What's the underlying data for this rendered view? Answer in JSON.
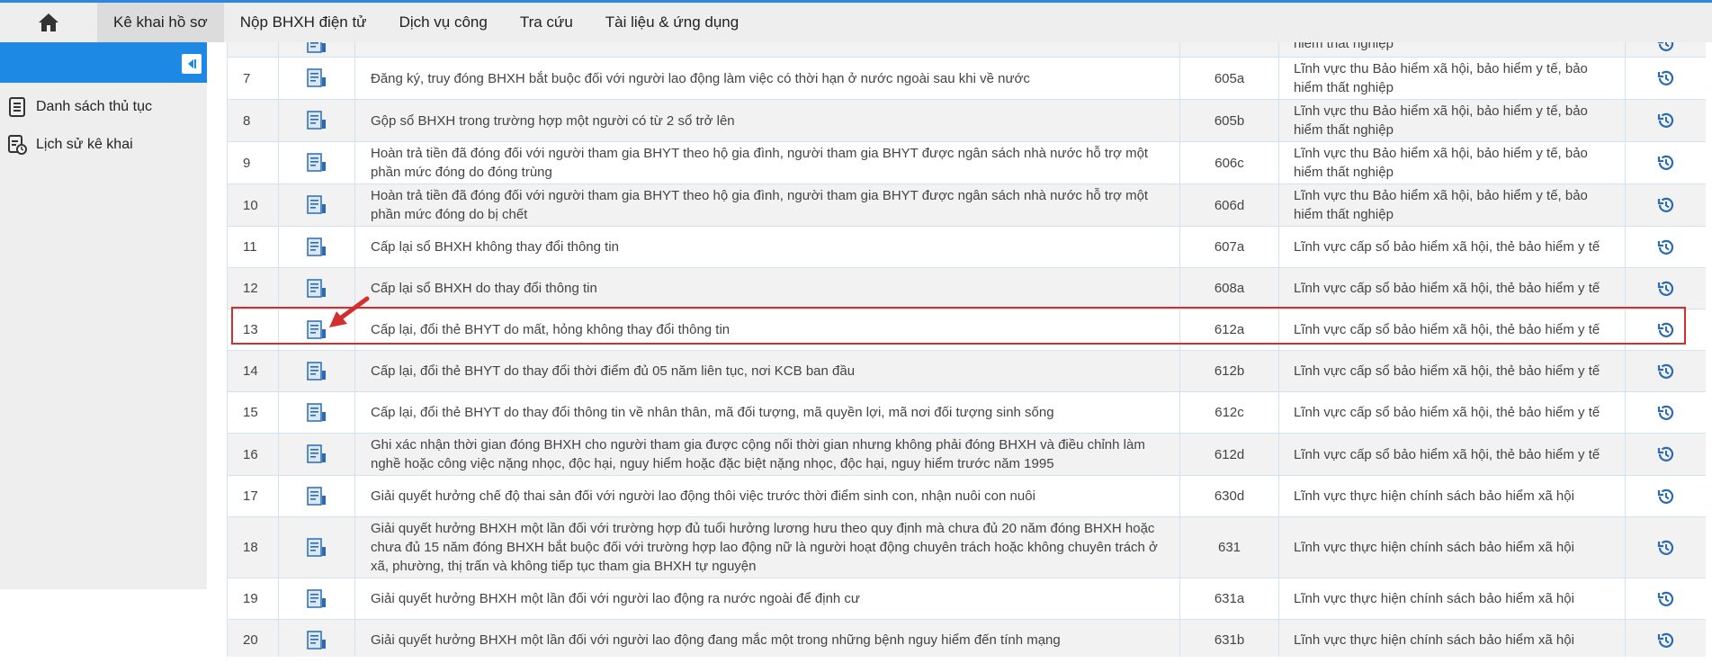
{
  "nav": {
    "items": [
      {
        "label": "Kê khai hồ sơ",
        "active": true
      },
      {
        "label": "Nộp BHXH điện tử",
        "active": false
      },
      {
        "label": "Dịch vụ công",
        "active": false
      },
      {
        "label": "Tra cứu",
        "active": false
      },
      {
        "label": "Tài liệu & ứng dụng",
        "active": false
      }
    ]
  },
  "sidebar": {
    "items": [
      {
        "label": "Danh sách thủ tục",
        "icon": "list-document-icon"
      },
      {
        "label": "Lịch sử kê khai",
        "icon": "history-document-icon"
      }
    ]
  },
  "colors": {
    "accent": "#1e88e5",
    "highlight": "#d32f2f",
    "icon_blue": "#2b6cb0"
  },
  "table": {
    "rows": [
      {
        "no": "",
        "name": "",
        "code": "",
        "field": "hiểm thất nghiệp"
      },
      {
        "no": "7",
        "name": "Đăng ký, truy đóng BHXH bắt buộc đối với người lao động làm việc có thời hạn ở nước ngoài sau khi về nước",
        "code": "605a",
        "field": "Lĩnh vực thu Bảo hiểm xã hội, bảo hiểm y tế, bảo hiểm thất nghiệp"
      },
      {
        "no": "8",
        "name": "Gộp sổ BHXH trong trường hợp một người có từ 2 sổ trở lên",
        "code": "605b",
        "field": "Lĩnh vực thu Bảo hiểm xã hội, bảo hiểm y tế, bảo hiểm thất nghiệp"
      },
      {
        "no": "9",
        "name": "Hoàn trả tiền đã đóng đối với người tham gia BHYT theo hộ gia đình, người tham gia BHYT được ngân sách nhà nước hỗ trợ một phần mức đóng do đóng trùng",
        "code": "606c",
        "field": "Lĩnh vực thu Bảo hiểm xã hội, bảo hiểm y tế, bảo hiểm thất nghiệp"
      },
      {
        "no": "10",
        "name": "Hoàn trả tiền đã đóng đối với người tham gia BHYT theo hộ gia đình, người tham gia BHYT được ngân sách nhà nước hỗ trợ một phần mức đóng do bị chết",
        "code": "606d",
        "field": "Lĩnh vực thu Bảo hiểm xã hội, bảo hiểm y tế, bảo hiểm thất nghiệp"
      },
      {
        "no": "11",
        "name": "Cấp lại sổ BHXH không thay đổi thông tin",
        "code": "607a",
        "field": "Lĩnh vực cấp sổ bảo hiểm xã hội, thẻ bảo hiểm y tế"
      },
      {
        "no": "12",
        "name": "Cấp lại sổ BHXH do thay đổi thông tin",
        "code": "608a",
        "field": "Lĩnh vực cấp sổ bảo hiểm xã hội, thẻ bảo hiểm y tế"
      },
      {
        "no": "13",
        "name": "Cấp lại, đổi thẻ BHYT do mất, hỏng không thay đổi thông tin",
        "code": "612a",
        "field": "Lĩnh vực cấp sổ bảo hiểm xã hội, thẻ bảo hiểm y tế"
      },
      {
        "no": "14",
        "name": "Cấp lại, đổi thẻ BHYT do thay đổi thời điểm đủ 05 năm liên tục, nơi KCB ban đầu",
        "code": "612b",
        "field": "Lĩnh vực cấp sổ bảo hiểm xã hội, thẻ bảo hiểm y tế"
      },
      {
        "no": "15",
        "name": "Cấp lại, đổi thẻ BHYT do thay đổi thông tin về nhân thân, mã đối tượng, mã quyền lợi, mã nơi đối tượng sinh sống",
        "code": "612c",
        "field": "Lĩnh vực cấp sổ bảo hiểm xã hội, thẻ bảo hiểm y tế"
      },
      {
        "no": "16",
        "name": "Ghi xác nhận thời gian đóng BHXH cho người tham gia được cộng nối thời gian nhưng không phải đóng BHXH và điều chỉnh làm nghề hoặc công việc nặng nhọc, độc hại, nguy hiểm hoặc đặc biệt nặng nhọc, độc hại, nguy hiểm trước năm 1995",
        "code": "612d",
        "field": "Lĩnh vực cấp sổ bảo hiểm xã hội, thẻ bảo hiểm y tế"
      },
      {
        "no": "17",
        "name": "Giải quyết hưởng chế độ thai sản đối với người lao động thôi việc trước thời điểm sinh con, nhận nuôi con nuôi",
        "code": "630d",
        "field": "Lĩnh vực thực hiện chính sách bảo hiểm xã hội"
      },
      {
        "no": "18",
        "name": "Giải quyết hưởng BHXH một lần đối với trường hợp đủ tuổi hưởng lương hưu theo quy định mà chưa đủ 20 năm đóng BHXH hoặc chưa đủ 15 năm đóng BHXH bắt buộc đối với trường hợp lao động nữ là người hoạt động chuyên trách hoặc không chuyên trách ở xã, phường, thị trấn và không tiếp tục tham gia BHXH tự nguyện",
        "code": "631",
        "field": "Lĩnh vực thực hiện chính sách bảo hiểm xã hội"
      },
      {
        "no": "19",
        "name": "Giải quyết hưởng BHXH một lần đối với người lao động ra nước ngoài để định cư",
        "code": "631a",
        "field": "Lĩnh vực thực hiện chính sách bảo hiểm xã hội"
      },
      {
        "no": "20",
        "name": "Giải quyết hưởng BHXH một lần đối với người lao động đang mắc một trong những bệnh nguy hiểm đến tính mạng",
        "code": "631b",
        "field": "Lĩnh vực thực hiện chính sách bảo hiểm xã hội"
      }
    ]
  }
}
